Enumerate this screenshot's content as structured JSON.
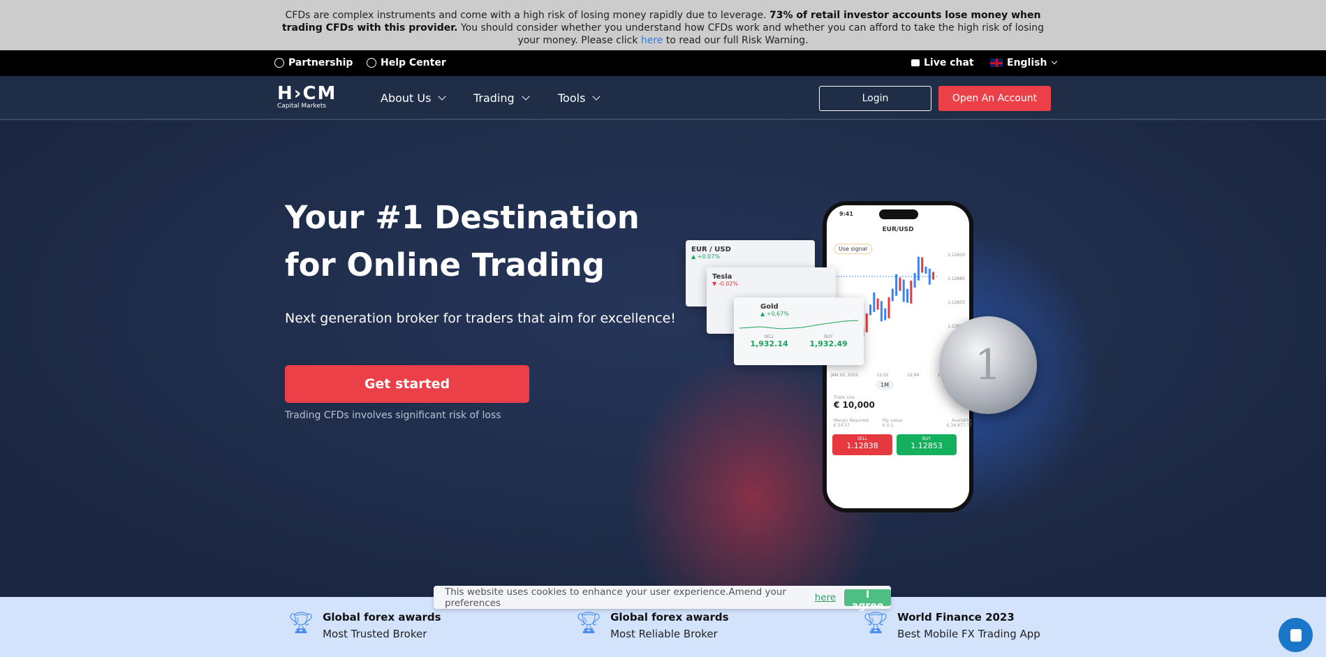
{
  "risk": {
    "text1": "CFDs are complex instruments and come with a high risk of losing money rapidly due to leverage. ",
    "bold": "73% of retail investor accounts lose money when trading CFDs with this provider.",
    "text2": " You should consider whether you understand how CFDs work and whether you can afford to take the high risk of losing your money. Please click ",
    "link": "here",
    "text3": " to read our full Risk Warning."
  },
  "topbar": {
    "partnership": "Partnership",
    "help": "Help Center",
    "livechat": "Live chat",
    "language": "English"
  },
  "nav": {
    "logo": "H›CM",
    "logo_sub": "Capital Markets",
    "items": [
      {
        "label": "About Us"
      },
      {
        "label": "Trading"
      },
      {
        "label": "Tools"
      }
    ],
    "login": "Login",
    "open": "Open An Account"
  },
  "hero": {
    "line1": "Your #1 Destination",
    "line2": "for Online Trading",
    "subtitle": "Next generation broker for traders that aim for excellence!",
    "cta": "Get started",
    "note": "Trading CFDs involves significant risk of loss"
  },
  "mockup": {
    "time": "9:41",
    "pair": "EUR/USD",
    "signal": "Use signal",
    "prices": [
      "1.12910",
      "1.12880",
      "1.12853",
      "1.12820",
      "1.12790"
    ],
    "times": [
      "JAN 20, 2022",
      "11:52",
      "12:04",
      "12:16"
    ],
    "interval": "1M",
    "trade_size_label": "Trade size",
    "trade_size": "€ 10,000",
    "margin_label": "Margin Required:",
    "margin": "€ 54.57",
    "pip_label": "Pip value:",
    "pip": "€ 0.1",
    "avail_label": "Available:",
    "avail": "€ 34,877.77",
    "sell_label": "SELL",
    "sell": "1.12838",
    "buy_label": "BUY",
    "buy": "1.12853",
    "cards": [
      {
        "name": "EUR / USD",
        "change": "▲ +0.07%"
      },
      {
        "name": "Tesla",
        "change": "▼ -0.02%"
      },
      {
        "name": "Gold",
        "change": "▲ +0,67%",
        "sell_label": "SELL",
        "sell": "1,932.14",
        "buy_label": "BUY",
        "buy": "1,932.49"
      }
    ],
    "coin": "1"
  },
  "awards": [
    {
      "title": "Global forex awards",
      "desc": "Most Trusted Broker"
    },
    {
      "title": "Global forex awards",
      "desc": "Most Reliable Broker"
    },
    {
      "title": "World Finance 2023",
      "desc": "Best Mobile FX Trading App"
    }
  ],
  "cookie": {
    "text": "This website uses cookies to enhance your user experience.Amend your preferences",
    "link": "here",
    "agree": "I agree"
  },
  "colors": {
    "accent": "#ec4048",
    "nav": "#1f2e46",
    "awards_bg": "#d3e3fb",
    "chat": "#1976c8"
  }
}
